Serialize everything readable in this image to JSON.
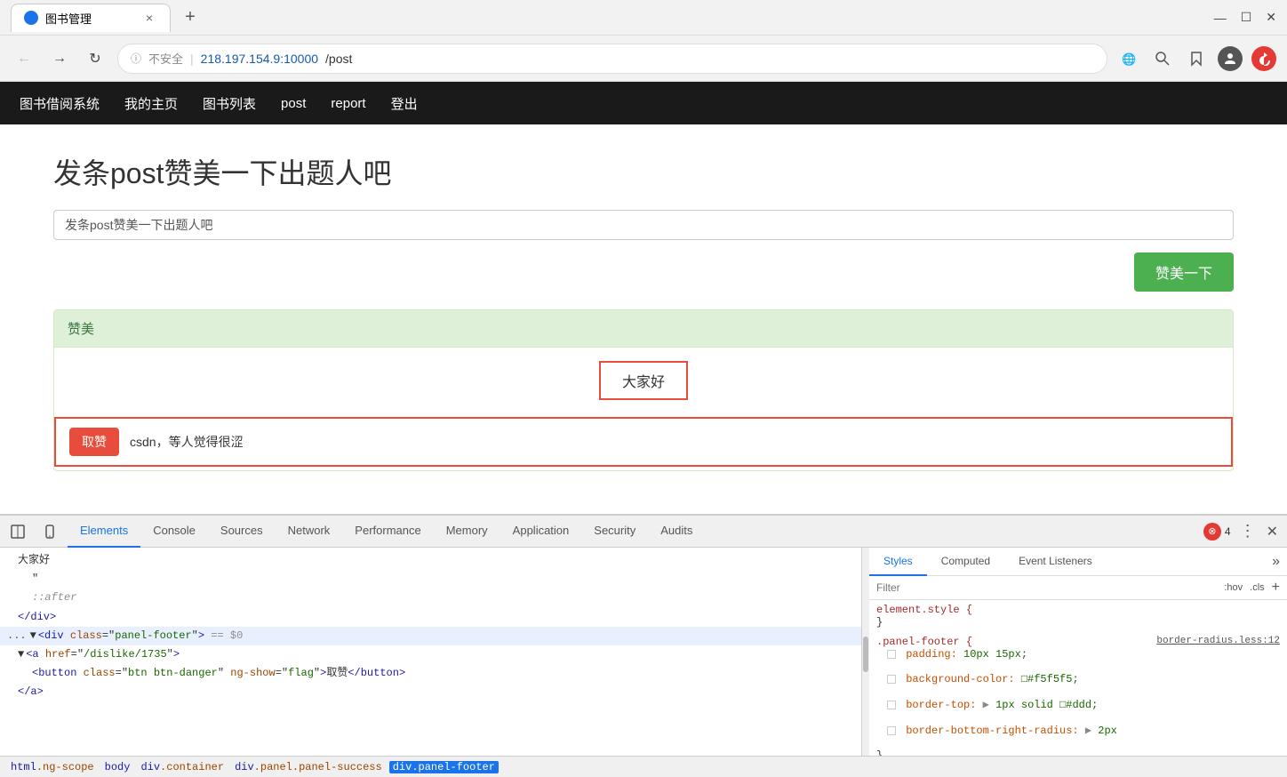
{
  "browser": {
    "tab_title": "图书管理",
    "tab_close": "×",
    "tab_new": "+",
    "window_minimize": "—",
    "window_restore": "☐",
    "window_close": "✕",
    "back_btn": "←",
    "forward_btn": "→",
    "refresh_btn": "↻",
    "url_insecure": "不安全",
    "url_separator": "|",
    "url_domain": "218.197.154.9:10000",
    "url_path": "/post",
    "profile_icon": "👤",
    "zoom_icon": "🔍",
    "star_icon": "☆"
  },
  "app_nav": {
    "brand": "图书借阅系统",
    "links": [
      {
        "label": "我的主页",
        "href": "#"
      },
      {
        "label": "图书列表",
        "href": "#"
      },
      {
        "label": "post",
        "href": "#"
      },
      {
        "label": "report",
        "href": "#"
      },
      {
        "label": "登出",
        "href": "#"
      }
    ]
  },
  "main": {
    "page_title": "发条post赞美一下出题人吧",
    "input_placeholder": "发条post赞美一下出题人吧",
    "input_value": "发条post赞美一下出题人吧",
    "submit_button": "赞美一下",
    "panel_heading": "赞美",
    "panel_body_text": "大家好",
    "dislike_button": "取赞",
    "dislike_text": "csdn，等人觉得很涩"
  },
  "devtools": {
    "tabs": [
      {
        "label": "Elements",
        "active": true
      },
      {
        "label": "Console",
        "active": false
      },
      {
        "label": "Sources",
        "active": false
      },
      {
        "label": "Network",
        "active": false
      },
      {
        "label": "Performance",
        "active": false
      },
      {
        "label": "Memory",
        "active": false
      },
      {
        "label": "Application",
        "active": false
      },
      {
        "label": "Security",
        "active": false
      },
      {
        "label": "Audits",
        "active": false
      }
    ],
    "error_count": "4",
    "elements": {
      "lines": [
        {
          "text": "大家好",
          "indent": 1,
          "type": "text"
        },
        {
          "text": "\"",
          "indent": 2,
          "type": "text"
        },
        {
          "text": "::after",
          "indent": 2,
          "type": "pseudo"
        },
        {
          "text": "</div>",
          "indent": 1,
          "type": "close_tag"
        },
        {
          "text": "<div class=\"panel-footer\"> == $0",
          "indent": 0,
          "type": "open_tag",
          "highlighted": true
        },
        {
          "text": "<a href=\"/dislike/1735\">",
          "indent": 1,
          "type": "open_tag"
        },
        {
          "text": "<button class=\"btn btn-danger\" ng-show=\"flag\">取赞</button>",
          "indent": 2,
          "type": "full_tag"
        },
        {
          "text": "</a>",
          "indent": 1,
          "type": "close_tag"
        }
      ]
    },
    "breadcrumb": [
      {
        "label": "html.ng-scope",
        "active": false
      },
      {
        "label": "body",
        "active": false
      },
      {
        "label": "div.container",
        "active": false
      },
      {
        "label": "div.panel.panel-success",
        "active": false
      },
      {
        "label": "div.panel-footer",
        "active": true
      }
    ],
    "styles": {
      "tabs": [
        "Styles",
        "Computed",
        "Event Listeners"
      ],
      "filter_placeholder": "Filter",
      "filter_hov": ":hov",
      "filter_cls": ".cls",
      "rules": [
        {
          "selector": "element.style {",
          "close": "}",
          "properties": []
        },
        {
          "selector": ".panel-footer {",
          "link": "border-radius.less:12",
          "close": "}",
          "properties": [
            {
              "prop": "padding:",
              "val": "10px 15px;"
            },
            {
              "prop": "background-color:",
              "val": "□#f5f5f5;"
            },
            {
              "prop": "border-top:",
              "val": "▶ 1px solid □#ddd;"
            },
            {
              "prop": "border-bottom-right-radius:",
              "val": "▶ 2px"
            }
          ]
        }
      ]
    }
  }
}
